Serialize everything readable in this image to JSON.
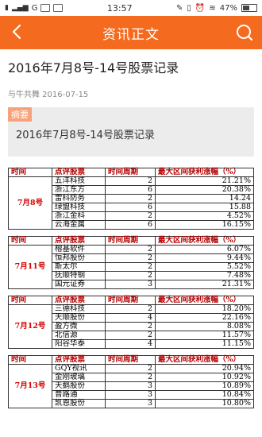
{
  "status": {
    "time": "13:57",
    "battery": "47%",
    "network": "G"
  },
  "header": {
    "title": "资讯正文"
  },
  "article": {
    "title": "2016年7月8号-14号股票记录",
    "author_date": "与牛共舞 2016-07-15",
    "summary_tag": "摘要",
    "summary_text": "2016年7月8号-14号股票记录"
  },
  "table": {
    "headers": [
      "时间",
      "点评股票",
      "时间周期",
      "最大区间获利涨幅（%）"
    ],
    "groups": [
      {
        "date": "7月8号",
        "rows": [
          [
            "五洋科技",
            "2",
            "21.21%"
          ],
          [
            "浙江东方",
            "6",
            "20.38%"
          ],
          [
            "雷科防务",
            "2",
            "14.24"
          ],
          [
            "绿盟科技",
            "6",
            "15.88"
          ],
          [
            "浙江金科",
            "2",
            "4.52%"
          ],
          [
            "云海金属",
            "6",
            "16.15%"
          ]
        ]
      },
      {
        "date": "7月11号",
        "rows": [
          [
            "榕基软件",
            "2",
            "6.07%"
          ],
          [
            "恒邦股份",
            "2",
            "9.44%"
          ],
          [
            "斯太尔",
            "2",
            "5.52%"
          ],
          [
            "抚顺特钢",
            "2",
            "7.48%"
          ],
          [
            "国元证券",
            "3",
            "21.31%"
          ]
        ]
      },
      {
        "date": "7月12号",
        "rows": [
          [
            "三德科技",
            "2",
            "18.20%"
          ],
          [
            "天顺股份",
            "4",
            "22.16%"
          ],
          [
            "盈方微",
            "2",
            "8.08%"
          ],
          [
            "北信源",
            "2",
            "11.57%"
          ],
          [
            "阳谷华泰",
            "4",
            "11.15%"
          ]
        ]
      },
      {
        "date": "7月13号",
        "rows": [
          [
            "GQY视讯",
            "2",
            "20.94%"
          ],
          [
            "金刚玻璃",
            "2",
            "10.92%"
          ],
          [
            "天鹅股份",
            "3",
            "10.89%"
          ],
          [
            "普路通",
            "3",
            "10.84%"
          ],
          [
            "凯恩股份",
            "3",
            "10.80%"
          ]
        ]
      }
    ]
  }
}
